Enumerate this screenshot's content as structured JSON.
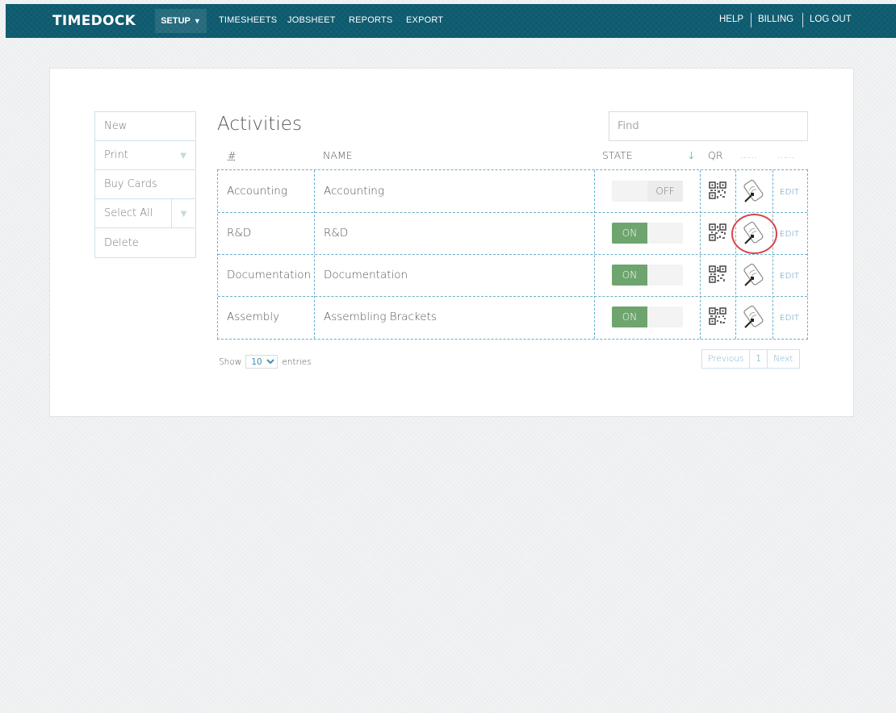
{
  "navbar": {
    "brand": "TIMEDOCK",
    "setup": "SETUP",
    "links": [
      "TIMESHEETS",
      "JOBSHEET",
      "REPORTS",
      "EXPORT"
    ],
    "right": [
      "HELP",
      "BILLING",
      "LOG OUT"
    ]
  },
  "actions": {
    "new": "New",
    "print": "Print",
    "buy_cards": "Buy Cards",
    "select_all": "Select All",
    "delete": "Delete"
  },
  "page": {
    "title": "Activities",
    "search_placeholder": "Find"
  },
  "table": {
    "headers": {
      "number": "#",
      "name": "NAME",
      "state": "STATE",
      "sort_indicator": "↓",
      "qr": "QR",
      "col6": "……",
      "col7": "……"
    },
    "rows": [
      {
        "code": "Accounting",
        "name": "Accounting",
        "state_label": "OFF",
        "state": "off",
        "edit": "EDIT"
      },
      {
        "code": "R&D",
        "name": "R&D",
        "state_label": "ON",
        "state": "on",
        "edit": "EDIT"
      },
      {
        "code": "Documentation",
        "name": "Documentation",
        "state_label": "ON",
        "state": "on",
        "edit": "EDIT"
      },
      {
        "code": "Assembly",
        "name": "Assembling Brackets",
        "state_label": "ON",
        "state": "on",
        "edit": "EDIT"
      }
    ]
  },
  "footer": {
    "show": "Show",
    "page_size": "10",
    "entries": "entries",
    "previous": "Previous",
    "current_page": "1",
    "next": "Next"
  },
  "colors": {
    "navbar": "#0d5a6e",
    "toggle_on": "#6ea56e",
    "link": "#3d8fb3",
    "highlight": "#d9454a"
  }
}
